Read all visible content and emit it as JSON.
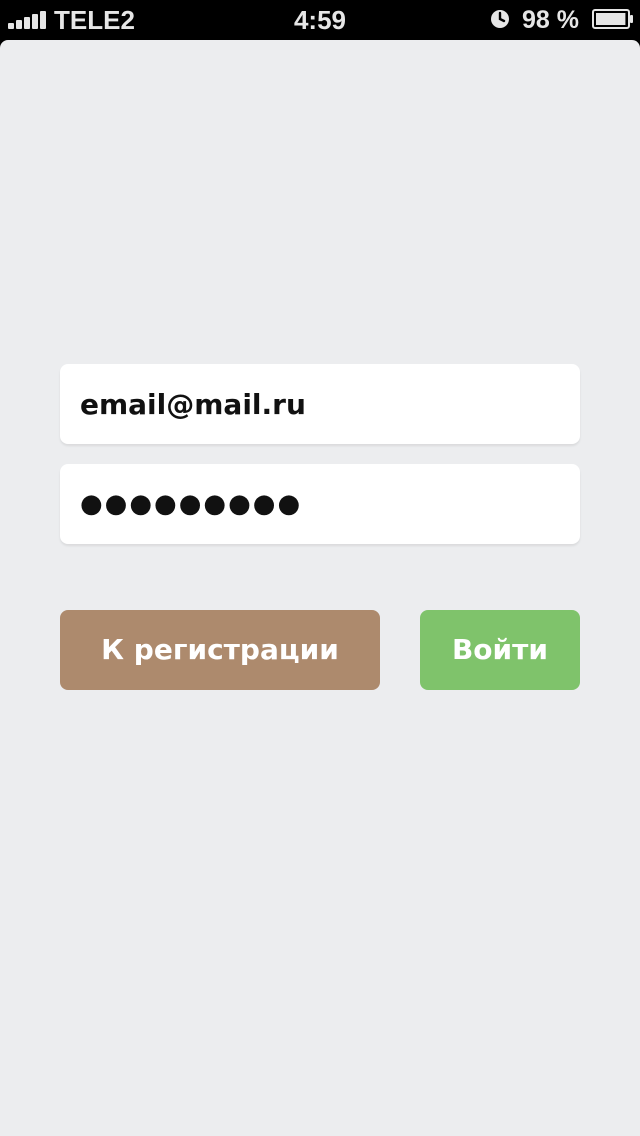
{
  "status_bar": {
    "carrier": "TELE2",
    "time": "4:59",
    "battery_percent": "98 %",
    "signal_bars": 5,
    "icons": [
      "signal-icon",
      "lock-rotation-icon",
      "battery-icon"
    ],
    "battery_level": 0.98
  },
  "login_form": {
    "email_value": "email@mail.ru",
    "password_value": "●●●●●●●●●"
  },
  "buttons": {
    "register_label": "К регистрации",
    "login_label": "Войти"
  },
  "colors": {
    "background": "#ecedef",
    "register_button": "#ad8a6d",
    "login_button": "#7fc36b",
    "field_background": "#ffffff",
    "status_bar": "#000000"
  }
}
